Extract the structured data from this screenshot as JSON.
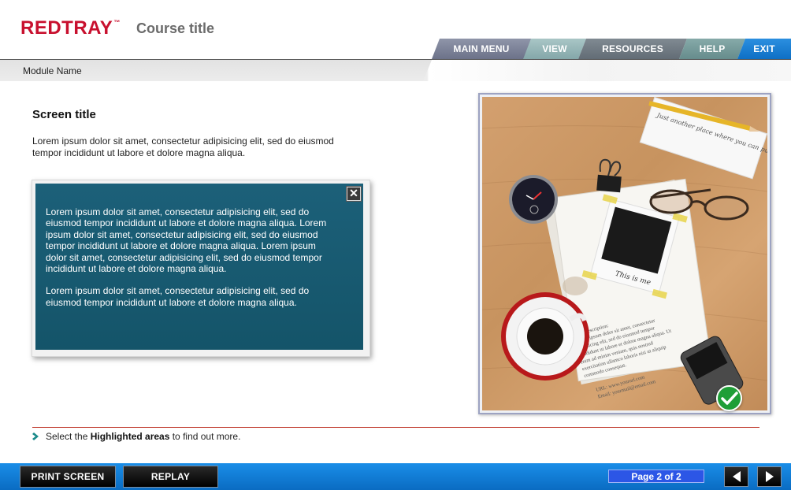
{
  "header": {
    "logo": "REDTRAY",
    "logo_tm": "™",
    "course_title": "Course title"
  },
  "nav": {
    "main_menu": "MAIN MENU",
    "view": "VIEW",
    "resources": "RESOURCES",
    "help": "HELP",
    "exit": "EXIT"
  },
  "module_name": "Module Name",
  "content": {
    "screen_title": "Screen title",
    "intro": "Lorem ipsum dolor sit amet, consectetur adipisicing elit, sed do eiusmod tempor incididunt ut labore et dolore magna aliqua."
  },
  "popup": {
    "close_label": "✕",
    "paragraph1": "Lorem ipsum dolor sit amet, consectetur adipisicing elit, sed do eiusmod tempor incididunt ut labore et dolore magna aliqua. Lorem ipsum dolor sit amet, consectetur adipisicing elit, sed do eiusmod tempor incididunt ut labore et dolore magna aliqua. Lorem ipsum dolor sit amet, consectetur adipisicing elit, sed do eiusmod tempor incididunt ut labore et dolore magna aliqua.",
    "paragraph2": "Lorem ipsum dolor sit amet, consectetur adipisicing elit, sed do eiusmod tempor incididunt ut labore et dolore magna aliqua."
  },
  "photo": {
    "note_text": "Just another place where you can put your note text",
    "polaroid_caption": "This is me",
    "description_text": "Your Description: Lorem ipsum dolor sit amet, consectetur adipisicing elit, sed do eiusmod tempor incididunt ut labore et dolore magna aliqua. Ut enim ad minim veniam, quis nostrud exercitation ullamco laboris nisi ut aliquip ex ea commodo consequat.",
    "url_text": "URL: www.yoururl.com",
    "email_text": "Email: yourmail@email.com"
  },
  "instruction": {
    "prefix": "Select the ",
    "highlight": "Highlighted areas",
    "suffix": " to find out more."
  },
  "footer": {
    "print_label": "PRINT SCREEN",
    "replay_label": "REPLAY",
    "page_indicator": "Page  2 of 2"
  },
  "colors": {
    "brand_red": "#c8102e",
    "popup_teal": "#1a5b73",
    "footer_blue": "#1a8ee8",
    "page_indicator": "#2c56e6",
    "check_green": "#1f9e37"
  }
}
